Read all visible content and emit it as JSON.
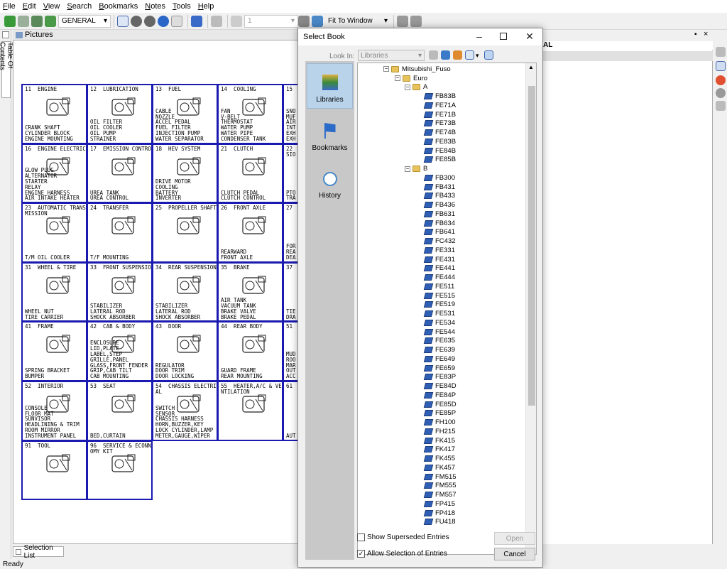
{
  "menu": [
    "File",
    "Edit",
    "View",
    "Search",
    "Bookmarks",
    "Notes",
    "Tools",
    "Help"
  ],
  "toolbar": {
    "catalog_value": "GENERAL",
    "page_value": "1",
    "zoom_value": "Fit To Window"
  },
  "left_tab": "Table Of Contents",
  "pictures_title": "Pictures",
  "right_panel_text": "AL",
  "cells": [
    {
      "title": "11  ENGINE",
      "lines": "CRANK SHAFT\nCYLINDER BLOCK\nENGINE MOUNTING"
    },
    {
      "title": "12  LUBRICATION",
      "lines": "        OIL FILTER\n        OIL COOLER\n        OIL PUMP\n        STRAINER"
    },
    {
      "title": "13  FUEL",
      "lines": "CABLE\nNOZZLE\nACCEL PEDAL\nFUEL FILTER\nINJECTION PUMP\nWATER SEPARATOR"
    },
    {
      "title": "14  COOLING",
      "lines": "FAN\nV-BELT\nTHERMOSTAT\nWATER PUMP\nWATER PIPE\nCONDENSER TANK"
    },
    {
      "title": "15",
      "lines": "SNO\nMUF\nAIR\nINT\nEXH\nEXH"
    },
    {
      "title": "16  ENGINE ELECTRICAL",
      "lines": "GLOW PLUG\nALTERNATOR\nSTARTER\nRELAY\nENGINE HARNESS\nAIR INTAKE HEATER"
    },
    {
      "title": "17  EMISSION CONTROL",
      "lines": "UREA TANK\nUREA CONTROL"
    },
    {
      "title": "18  HEV SYSTEM",
      "lines": "DRIVE MOTOR\nCOOLING\nBATTERY\nINVERTER"
    },
    {
      "title": "21  CLUTCH",
      "lines": "CLUTCH PEDAL\nCLUTCH CONTROL"
    },
    {
      "title": "22\nSIO",
      "lines": "PTO\nTRA"
    },
    {
      "title": "23  AUTOMATIC TRANS-\nMISSION",
      "lines": "T/M OIL COOLER"
    },
    {
      "title": "24  TRANSFER",
      "lines": "T/F MOUNTING"
    },
    {
      "title": "25  PROPELLER SHAFT",
      "lines": ""
    },
    {
      "title": "26  FRONT AXLE",
      "lines": "REARWARD\nFRONT AXLE"
    },
    {
      "title": "27",
      "lines": "FOR\nREA\nDEA"
    },
    {
      "title": "31  WHEEL & TIRE",
      "lines": "WHEEL NUT\nTIRE CARRIER"
    },
    {
      "title": "33  FRONT SUSPENSION",
      "lines": "STABILIZER\nLATERAL ROD\nSHOCK ABSORBER"
    },
    {
      "title": "34  REAR SUSPENSION",
      "lines": "STABILIZER\nLATERAL ROD\nSHOCK ABSORBER"
    },
    {
      "title": "35  BRAKE",
      "lines": "AIR TANK\nVACUUM TANK\nBRAKE VALVE\nBRAKE PEDAL"
    },
    {
      "title": "37",
      "lines": "TIE\nDRA"
    },
    {
      "title": "41  FRAME",
      "lines": "SPRING BRACKET\nBUMPER"
    },
    {
      "title": "42  CAB & BODY",
      "lines": "ENCLOSURE\nLID,PLATE\nLABEL,STEP\nGRILLE,PANEL\nGLASS,FRONT FENDER\nGRIP,CAB TILT\nCAB MOUNTING"
    },
    {
      "title": "43  DOOR",
      "lines": "REGULATOR\nDOOR TRIM\nDOOR LOCKING"
    },
    {
      "title": "44  REAR BODY",
      "lines": "GUARD FRAME\nREAR MOUNTING"
    },
    {
      "title": "51",
      "lines": "MUD\nROO\nMAR\nOUT\nACC"
    },
    {
      "title": "52  INTERIOR",
      "lines": "CONSOLE\nFLOOR MAT\nSUNVISOR\nHEADLINING & TRIM\nROOM MIRROR\nINSTRUMENT PANEL"
    },
    {
      "title": "53  SEAT",
      "lines": "BED,CURTAIN"
    },
    {
      "title": "54  CHASSIS ELECTRIC-\nAL",
      "lines": "SWITCH\nSENSOR\nCHASSIS HARNESS\nHORN,BUZZER,KEY\nLOCK CYLINDER,LAMP\nMETER,GAUGE,WIPER"
    },
    {
      "title": "55  HEATER,A/C & VE-\nNTILATION",
      "lines": ""
    },
    {
      "title": "61",
      "lines": "AUT"
    },
    {
      "title": "91  TOOL",
      "lines": ""
    },
    {
      "title": "96  SERVICE & ECONN-\nOMY KIT",
      "lines": ""
    }
  ],
  "dialog": {
    "title": "Select Book",
    "look_in_label": "Look In:",
    "look_in_value": "Libraries",
    "places": [
      "Libraries",
      "Bookmarks",
      "History"
    ],
    "tree_root": "Mitsubishi_Fuso",
    "tree_region": "Euro",
    "folder_a": "A",
    "folder_a_items": [
      "FB83B",
      "FE71A",
      "FE71B",
      "FE73B",
      "FE74B",
      "FE83B",
      "FE84B",
      "FE85B"
    ],
    "folder_b": "B",
    "folder_b_items": [
      "FB300",
      "FB431",
      "FB433",
      "FB436",
      "FB631",
      "FB634",
      "FB641",
      "FC432",
      "FE331",
      "FE431",
      "FE441",
      "FE444",
      "FE511",
      "FE515",
      "FE519",
      "FE531",
      "FE534",
      "FE544",
      "FE635",
      "FE639",
      "FE649",
      "FE659",
      "FE83P",
      "FE84D",
      "FE84P",
      "FE85D",
      "FE85P",
      "FH100",
      "FH215",
      "FK415",
      "FK417",
      "FK455",
      "FK457",
      "FM515",
      "FM555",
      "FM557",
      "FP415",
      "FP418",
      "FU418"
    ],
    "show_superseded": "Show Superseded Entries",
    "allow_selection": "Allow Selection of Entries",
    "open_button": "Open",
    "cancel_button": "Cancel"
  },
  "selection_list_tab": "Selection List",
  "status": "Ready"
}
